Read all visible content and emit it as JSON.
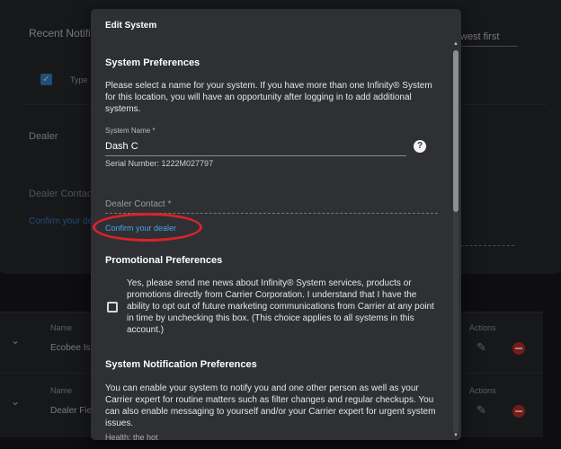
{
  "background": {
    "recent_title": "Recent Notific",
    "sort_label": "west first",
    "type_column": "Type",
    "dealer_label": "Dealer",
    "dealer_contact_label": "Dealer Contac",
    "confirm_link": "Confirm your de",
    "rows": [
      {
        "name_label": "Name",
        "name_value": "Ecobee Isl",
        "actions_label": "Actions"
      },
      {
        "name_label": "Name",
        "name_value": "Dealer Fiel",
        "actions_label": "Actions"
      }
    ]
  },
  "modal": {
    "title": "Edit System",
    "system_preferences": {
      "title": "System Preferences",
      "description": "Please select a name for your system. If you have more than one Infinity® System for this location, you will have an opportunity after logging in to add additional systems.",
      "system_name_label": "System Name *",
      "system_name_value": "Dash C",
      "help_icon": "?",
      "serial_number": "Serial Number: 1222M027797",
      "dealer_contact_placeholder": "Dealer Contact *",
      "confirm_dealer_link": "Confirm your dealer"
    },
    "promotional_preferences": {
      "title": "Promotional Preferences",
      "opt_in_text": "Yes, please send me news about Infinity® System services, products or promotions directly from Carrier Corporation. I understand that I have the ability to opt out of future marketing communications from Carrier at any point in time by unchecking this box. (This choice applies to all systems in this account.)",
      "opt_in_checked": false
    },
    "notification_preferences": {
      "title": "System Notification Preferences",
      "description": "You can enable your system to notify you and one other person as well as your Carrier expert for routine matters such as filter changes and regular checkups. You can also enable messaging to yourself and/or your Carrier expert for urgent system issues.",
      "truncated_label": "Health; the hot"
    }
  },
  "colors": {
    "accent": "#4aa3e8",
    "annotation": "#d8232a",
    "delete": "#d9302c"
  }
}
